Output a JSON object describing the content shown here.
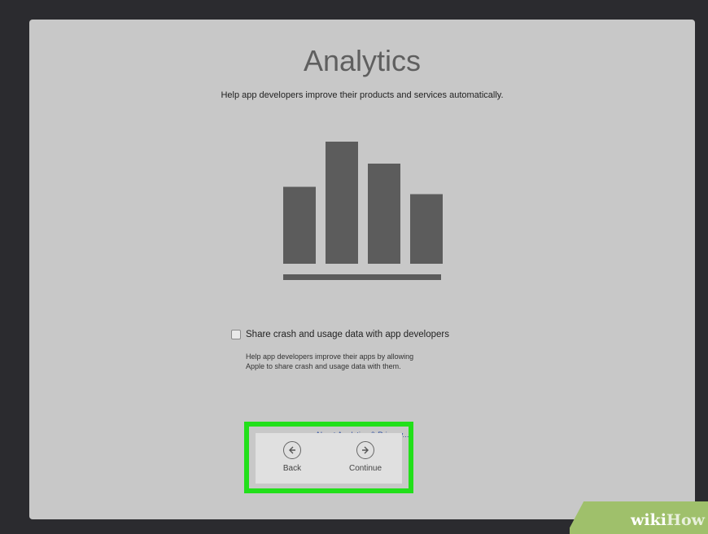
{
  "page": {
    "title": "Analytics",
    "subtitle": "Help app developers improve their products and services automatically."
  },
  "illustration": {
    "type": "bar-chart-icon",
    "bar_levels": [
      0.63,
      1.0,
      0.82,
      0.57
    ],
    "color": "#5c5c5c"
  },
  "share_option": {
    "checked": false,
    "label": "Share crash and usage data with app developers",
    "description_line1": "Help app developers improve their apps by allowing",
    "description_line2": "Apple to share crash and usage data with them."
  },
  "about_link": "About Analytics & Privacy...",
  "navigation": {
    "back_label": "Back",
    "back_icon": "arrow-left-circle-icon",
    "continue_label": "Continue",
    "continue_icon": "arrow-right-circle-icon",
    "highlight_color": "#22e01a"
  },
  "watermark": {
    "wiki": "wiki",
    "how": "How"
  }
}
